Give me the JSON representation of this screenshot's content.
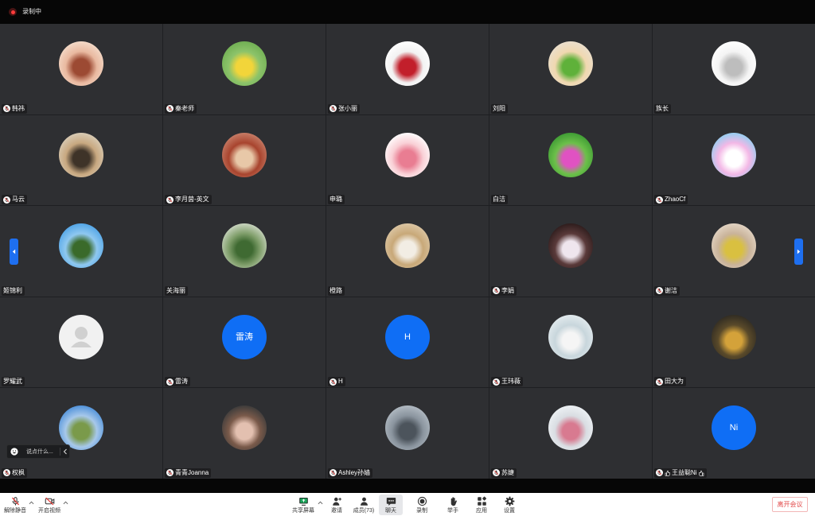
{
  "recording": {
    "label": "录制中"
  },
  "colors": {
    "tile_bg": "#2e2f32",
    "grid_line": "#1e1f22",
    "initials_avatar": "#0f6ef5",
    "nav_arrow": "#1e6ff0",
    "leave_text": "#e24a4a",
    "share_green": "#19a65a",
    "recording_dot": "#ff3b3b"
  },
  "participants": [
    {
      "name": "韩祎",
      "mic_muted": true,
      "avatar_colors": [
        "#f4dccb",
        "#e9b9a0",
        "#9c4a33"
      ]
    },
    {
      "name": "秦老师",
      "mic_muted": true,
      "avatar_colors": [
        "#6fae52",
        "#8cc36a",
        "#f2d53a"
      ]
    },
    {
      "name": "张小丽",
      "mic_muted": true,
      "avatar_colors": [
        "#ffffff",
        "#f2f2f2",
        "#c21f2b"
      ]
    },
    {
      "name": "刘阳",
      "mic_muted": false,
      "avatar_colors": [
        "#eadfcf",
        "#f0d8b0",
        "#5fb13a"
      ]
    },
    {
      "name": "族长",
      "mic_muted": false,
      "avatar_colors": [
        "#ffffff",
        "#f4f4f4",
        "#bdbdbd"
      ]
    },
    {
      "name": "马云",
      "mic_muted": true,
      "avatar_colors": [
        "#d9cdb8",
        "#c8a880",
        "#3e3328"
      ]
    },
    {
      "name": "李月茵-英文",
      "mic_muted": true,
      "avatar_colors": [
        "#c8806a",
        "#a8442e",
        "#e8c8a8"
      ]
    },
    {
      "name": "申璐",
      "mic_muted": false,
      "avatar_colors": [
        "#ffffff",
        "#f9d0d6",
        "#e97d92"
      ]
    },
    {
      "name": "白洁",
      "mic_muted": false,
      "avatar_colors": [
        "#3c9a33",
        "#6cc04a",
        "#e052c2"
      ]
    },
    {
      "name": "ZhaoCf",
      "mic_muted": true,
      "avatar_colors": [
        "#8fd0f2",
        "#f3b8e6",
        "#ffffff"
      ]
    },
    {
      "name": "姬锦利",
      "mic_muted": false,
      "avatar_colors": [
        "#4ea3e6",
        "#8fc8f0",
        "#3a6a2a"
      ]
    },
    {
      "name": "关海丽",
      "mic_muted": false,
      "avatar_colors": [
        "#cfd9c6",
        "#7f9e6a",
        "#3f6a32"
      ]
    },
    {
      "name": "橙路",
      "mic_muted": false,
      "avatar_colors": [
        "#dcc7a6",
        "#c8a878",
        "#f2ede4"
      ]
    },
    {
      "name": "李娟",
      "mic_muted": true,
      "avatar_colors": [
        "#2b1b1b",
        "#5a3a3a",
        "#efe6ee"
      ]
    },
    {
      "name": "谢洁",
      "mic_muted": true,
      "avatar_colors": [
        "#e3d5c5",
        "#c9b39a",
        "#d9c040"
      ]
    },
    {
      "name": "罗耀武",
      "mic_muted": false,
      "avatar_icon": "user-placeholder-icon"
    },
    {
      "name": "雷涛",
      "mic_muted": true,
      "avatar_text": "雷涛"
    },
    {
      "name": "H",
      "mic_muted": true,
      "avatar_text": "H"
    },
    {
      "name": "王玮薇",
      "mic_muted": true,
      "avatar_colors": [
        "#e3ebee",
        "#c8d6dc",
        "#f5f5f5"
      ]
    },
    {
      "name": "田大为",
      "mic_muted": true,
      "avatar_colors": [
        "#2e2a22",
        "#5a4a2a",
        "#d4a23a"
      ]
    },
    {
      "name": "权枫",
      "mic_muted": true,
      "avatar_colors": [
        "#4b8fd9",
        "#a7c8ea",
        "#7a9a4a"
      ]
    },
    {
      "name": "青青Joanna",
      "mic_muted": true,
      "avatar_colors": [
        "#3a3a3a",
        "#7a5a4a",
        "#e3c0b0"
      ]
    },
    {
      "name": "Ashley孙嫱",
      "mic_muted": true,
      "avatar_colors": [
        "#b3bcc4",
        "#8a949e",
        "#4c545c"
      ]
    },
    {
      "name": "苏婕",
      "mic_muted": true,
      "avatar_colors": [
        "#eef2f5",
        "#d9dde2",
        "#d87a90"
      ]
    },
    {
      "name": "王益聪Ni",
      "mic_muted": true,
      "avatar_text": "Ni",
      "name_icon": "thumbs-up-icon"
    }
  ],
  "chat_input": {
    "placeholder": "说点什么..."
  },
  "toolbar": {
    "unmute": {
      "label": "解除静音",
      "icon": "mic-muted-icon"
    },
    "video": {
      "label": "开启视频",
      "icon": "video-off-icon"
    },
    "share": {
      "label": "共享屏幕",
      "icon": "share-screen-icon"
    },
    "invite": {
      "label": "邀请",
      "icon": "invite-icon"
    },
    "members": {
      "label": "成员(73)",
      "icon": "members-icon"
    },
    "chat": {
      "label": "聊天",
      "icon": "chat-icon",
      "active": true
    },
    "record": {
      "label": "录制",
      "icon": "record-icon"
    },
    "raise_hand": {
      "label": "举手",
      "icon": "raise-hand-icon"
    },
    "apps": {
      "label": "应用",
      "icon": "apps-icon"
    },
    "settings": {
      "label": "设置",
      "icon": "settings-icon"
    },
    "leave": {
      "label": "离开会议"
    }
  }
}
